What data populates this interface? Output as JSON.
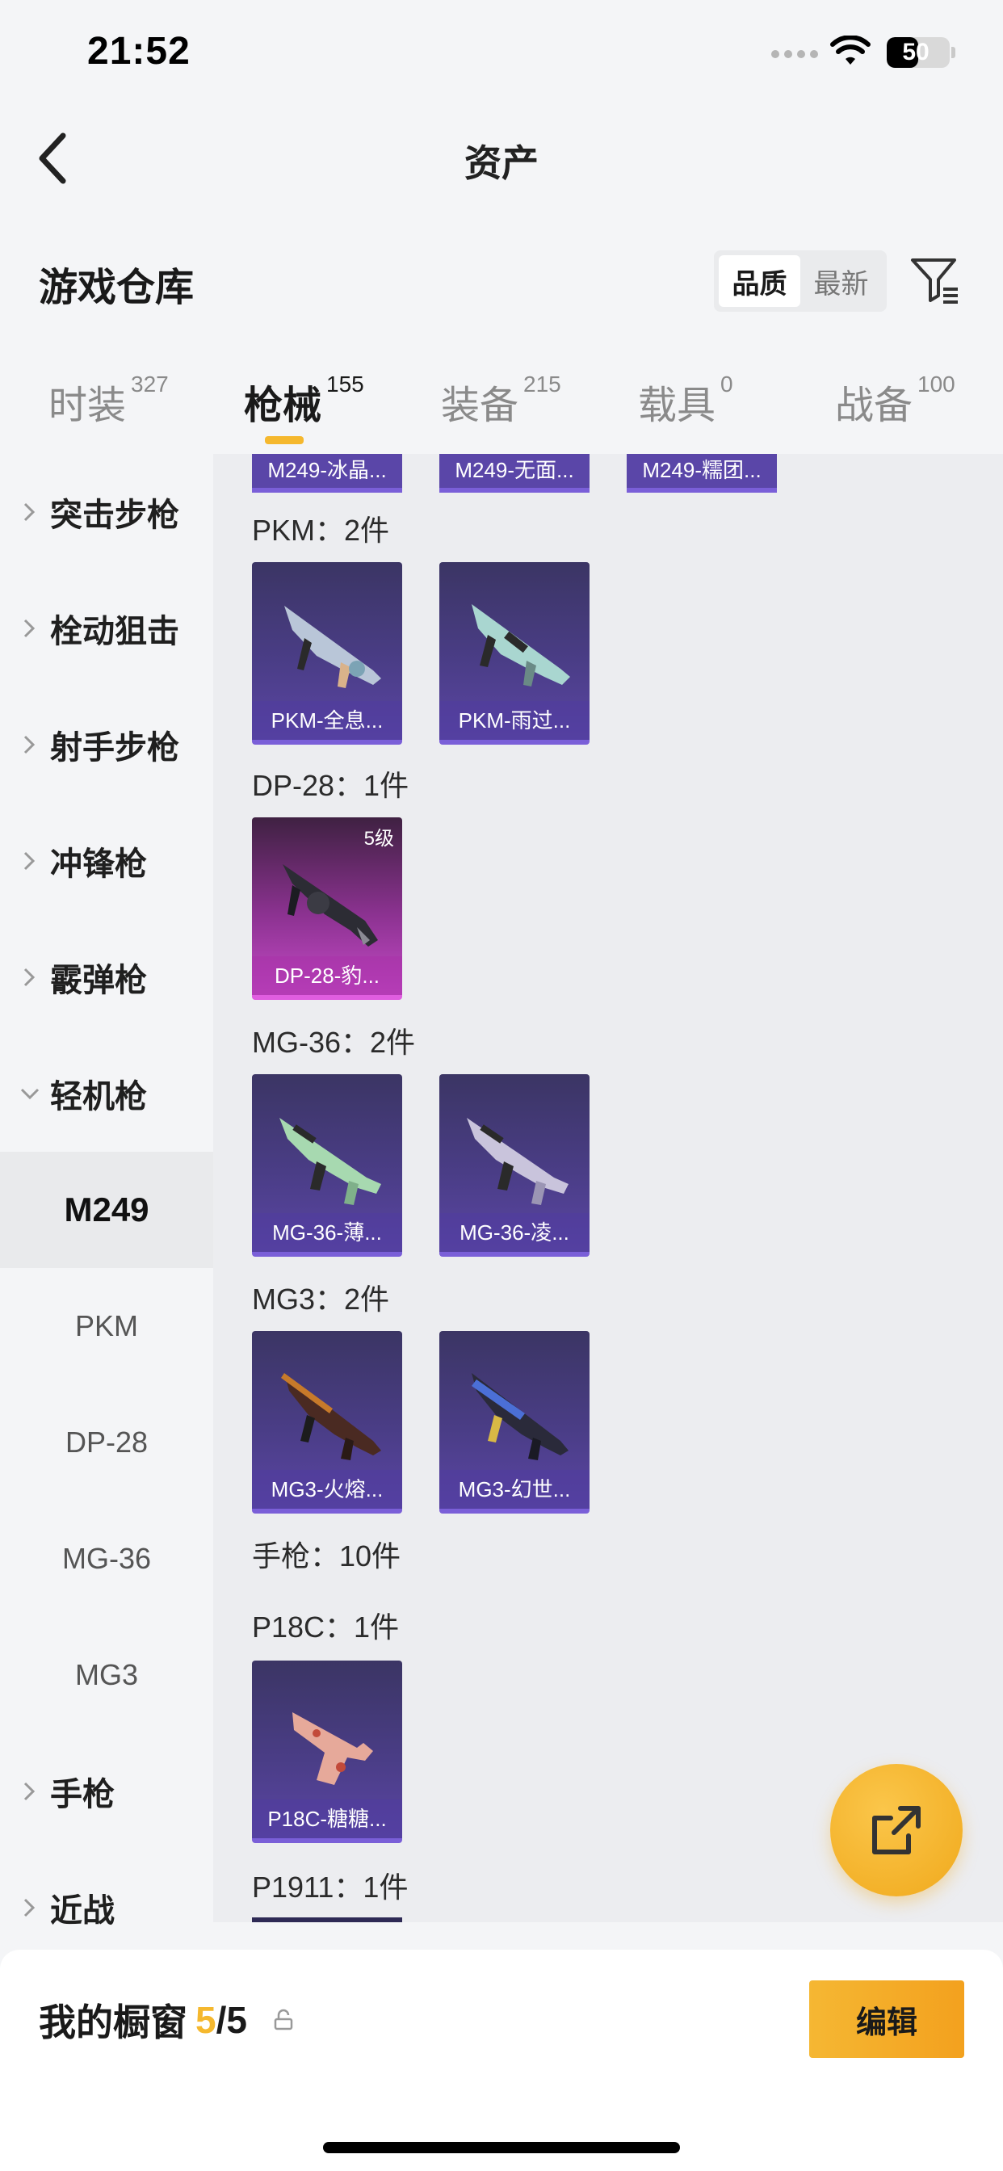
{
  "status_bar": {
    "time": "21:52",
    "battery": "50",
    "battery_level": 0.5
  },
  "nav": {
    "title": "资产"
  },
  "section": {
    "title": "游戏仓库"
  },
  "sort": {
    "options": [
      "品质",
      "最新"
    ],
    "selected": "品质"
  },
  "tabs": [
    {
      "label": "时装",
      "count": "327"
    },
    {
      "label": "枪械",
      "count": "155",
      "active": true
    },
    {
      "label": "装备",
      "count": "215"
    },
    {
      "label": "载具",
      "count": "0"
    },
    {
      "label": "战备",
      "count": "100"
    }
  ],
  "sidebar": {
    "categories": [
      "突击步枪",
      "栓动狙击",
      "射手步枪",
      "冲锋枪",
      "霰弹枪",
      "轻机枪"
    ],
    "subcategories": [
      "M249",
      "PKM",
      "DP-28",
      "MG-36",
      "MG3"
    ],
    "categories_after": [
      "手枪",
      "近战"
    ]
  },
  "content": {
    "partial_cards": [
      "M249-冰晶...",
      "M249-无面...",
      "M249-糯团..."
    ],
    "groups": [
      {
        "label": "PKM：2件",
        "items": [
          {
            "name": "PKM-全息..."
          },
          {
            "name": "PKM-雨过..."
          }
        ]
      },
      {
        "label": "DP-28：1件",
        "items": [
          {
            "name": "DP-28-豹...",
            "badge": "5级",
            "rarity": "pink"
          }
        ]
      },
      {
        "label": "MG-36：2件",
        "items": [
          {
            "name": "MG-36-薄..."
          },
          {
            "name": "MG-36-凌..."
          }
        ]
      },
      {
        "label": "MG3：2件",
        "items": [
          {
            "name": "MG3-火熔..."
          },
          {
            "name": "MG3-幻世..."
          }
        ]
      }
    ],
    "pistol_header": "手枪：10件",
    "p18c_label": "P18C：1件",
    "p18c_item": {
      "name": "P18C-糖糖..."
    },
    "p1911_label": "P1911：1件"
  },
  "bottom": {
    "showcase_label": "我的橱窗",
    "showcase_count": "5",
    "showcase_total": "/5",
    "edit_label": "编辑"
  },
  "colors": {
    "accent": "#f5b82e",
    "card_purple": "#4a3d86",
    "card_pink": "#c44ac6"
  }
}
